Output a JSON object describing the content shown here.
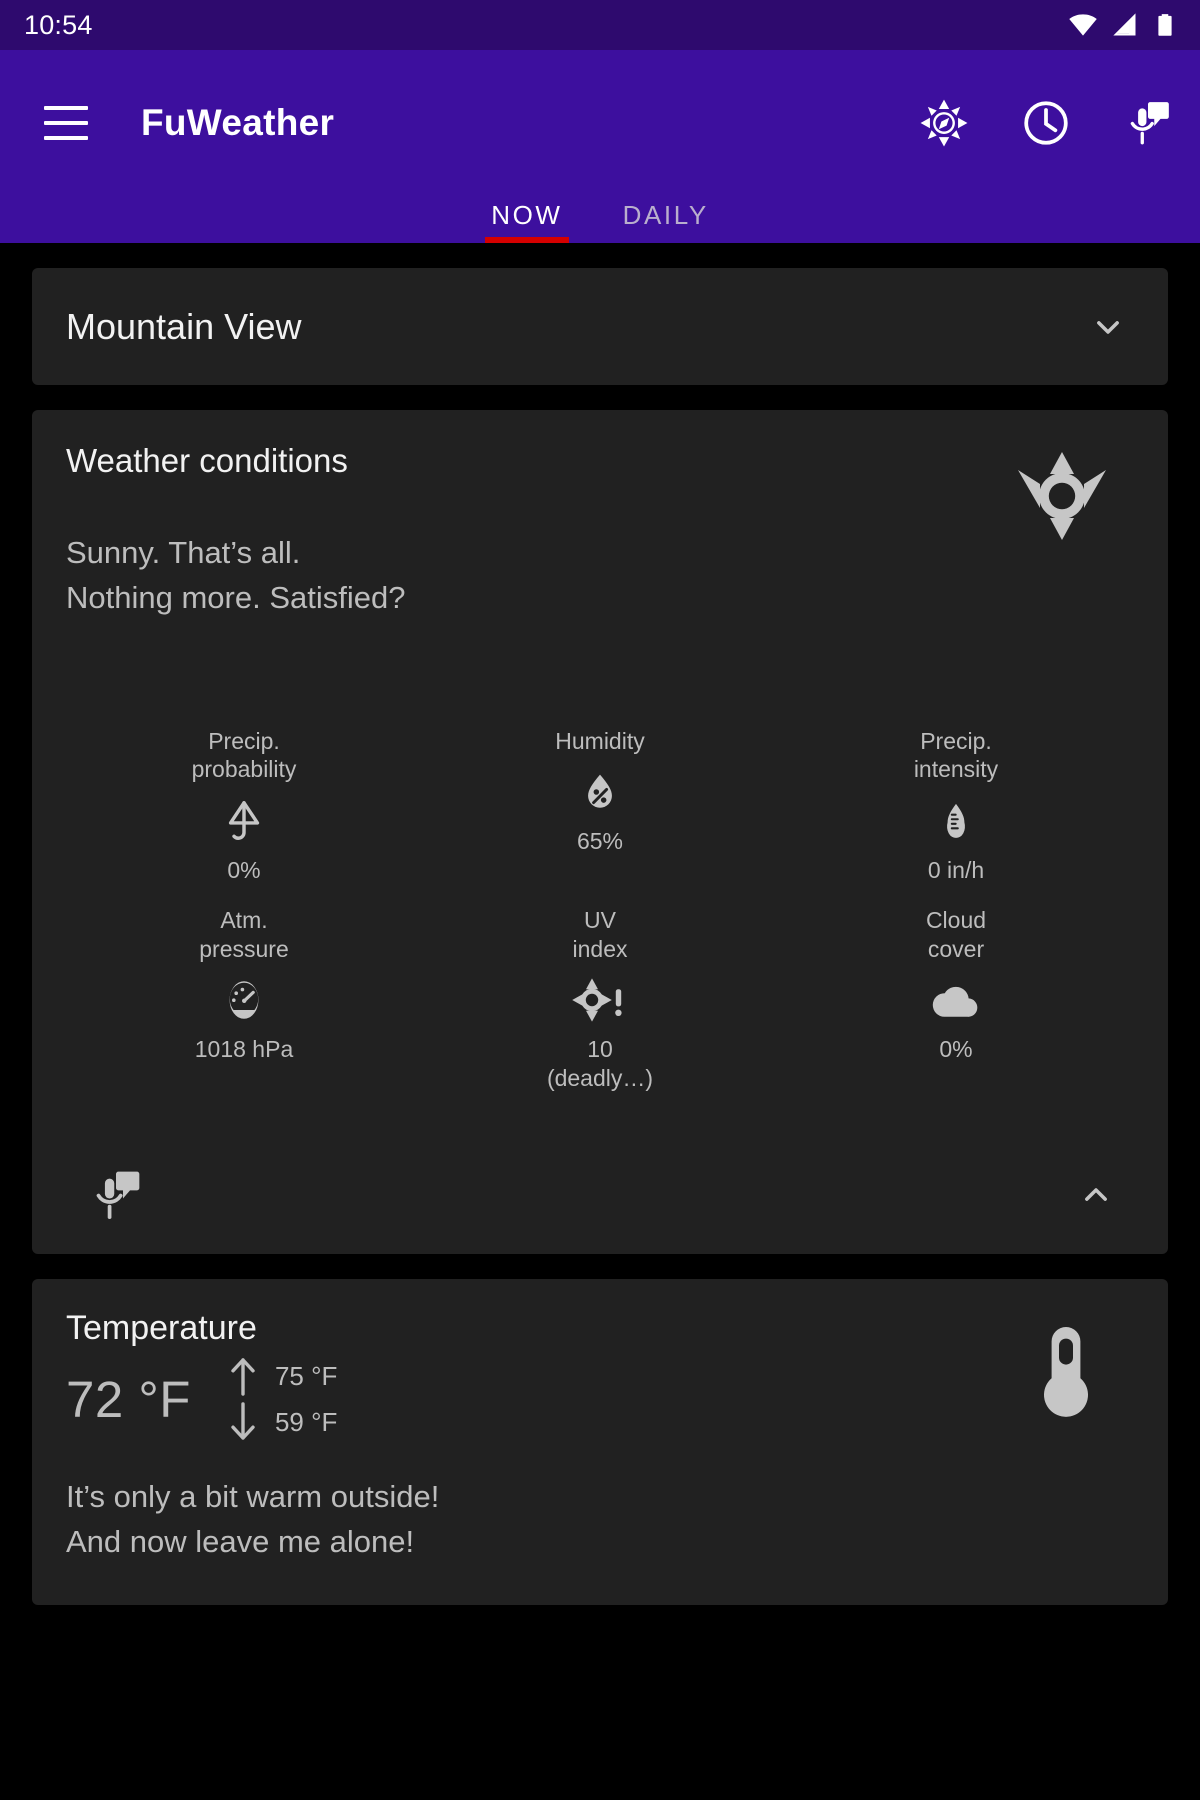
{
  "status_bar": {
    "time": "10:54",
    "icons": [
      "wifi-icon",
      "cellular-signal-icon",
      "battery-icon"
    ]
  },
  "app_bar": {
    "menu_icon": "hamburger-menu-icon",
    "title": "FuWeather",
    "actions": [
      {
        "name": "compass-icon",
        "label": "Compass"
      },
      {
        "name": "clock-icon",
        "label": "Clock"
      },
      {
        "name": "voice-comment-icon",
        "label": "Voice"
      }
    ],
    "accent_color": "#3d0f9e",
    "status_bar_color": "#2e0a6e",
    "indicator_color": "#d50000"
  },
  "tabs": [
    {
      "label": "NOW",
      "active": true
    },
    {
      "label": "DAILY",
      "active": false
    }
  ],
  "location_card": {
    "name": "Mountain View",
    "expand_icon": "chevron-down-icon"
  },
  "weather_conditions": {
    "title": "Weather conditions",
    "condition_icon": "sun-icon",
    "description_line1": "Sunny. That’s all.",
    "description_line2": "Nothing more. Satisfied?",
    "metrics": [
      {
        "label_line1": "Precip.",
        "label_line2": "probability",
        "icon": "umbrella-icon",
        "value": "0%",
        "value_line2": ""
      },
      {
        "label_line1": "Humidity",
        "label_line2": "",
        "icon": "humidity-droplet-icon",
        "value": "65%",
        "value_line2": ""
      },
      {
        "label_line1": "Precip.",
        "label_line2": "intensity",
        "icon": "rain-gauge-icon",
        "value": "0 in/h",
        "value_line2": ""
      },
      {
        "label_line1": "Atm.",
        "label_line2": "pressure",
        "icon": "barometer-icon",
        "value": "1018  hPa",
        "value_line2": ""
      },
      {
        "label_line1": "UV",
        "label_line2": "index",
        "icon": "uv-index-icon",
        "value": "10",
        "value_line2": "(deadly…)"
      },
      {
        "label_line1": "Cloud",
        "label_line2": "cover",
        "icon": "cloud-icon",
        "value": "0%",
        "value_line2": ""
      }
    ],
    "speak_icon": "voice-comment-icon",
    "collapse_icon": "chevron-up-icon"
  },
  "temperature_card": {
    "title": "Temperature",
    "current": "72 °F",
    "max_icon": "arrow-up-icon",
    "max": "75 °F",
    "min_icon": "arrow-down-icon",
    "min": "59 °F",
    "thermometer_icon": "thermometer-icon",
    "description_line1": "It’s only a bit warm outside!",
    "description_line2": "And now leave me alone!"
  },
  "theme": {
    "background": "#000000",
    "card_background": "#212121",
    "primary_text": "#f2f2f2",
    "secondary_text": "#bdbdbd",
    "icon_fill": "#c6c6c6"
  }
}
